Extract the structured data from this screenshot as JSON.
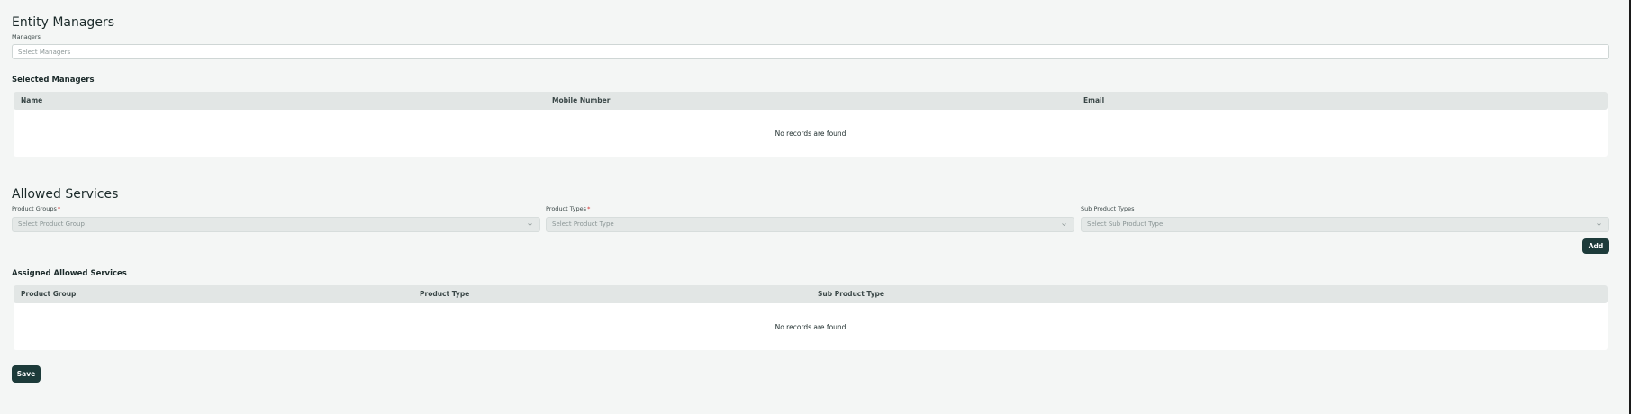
{
  "managers_section": {
    "title": "Entity Managers",
    "field_label": "Managers",
    "placeholder": "Select Managers"
  },
  "selected_managers": {
    "heading": "Selected Managers",
    "columns": [
      "Name",
      "Mobile Number",
      "Email"
    ],
    "empty_text": "No records are found"
  },
  "allowed_services": {
    "title": "Allowed Services",
    "product_groups": {
      "label": "Product Groups",
      "required_mark": "*",
      "placeholder": "Select Product Group"
    },
    "product_types": {
      "label": "Product Types",
      "required_mark": "*",
      "placeholder": "Select Product Type"
    },
    "sub_product_types": {
      "label": "Sub Product Types",
      "placeholder": "Select Sub Product Type"
    },
    "add_label": "Add"
  },
  "assigned_services": {
    "heading": "Assigned Allowed Services",
    "columns": [
      "Product Group",
      "Product Type",
      "Sub Product Type"
    ],
    "empty_text": "No records are found"
  },
  "save_label": "Save",
  "icons": {
    "dropdown": "chevron-down-icon"
  },
  "colors": {
    "primary_button": "#1d3b3a",
    "required": "#d2302f",
    "page_background": "#f4f6f5",
    "table_header": "#e2e6e5"
  }
}
